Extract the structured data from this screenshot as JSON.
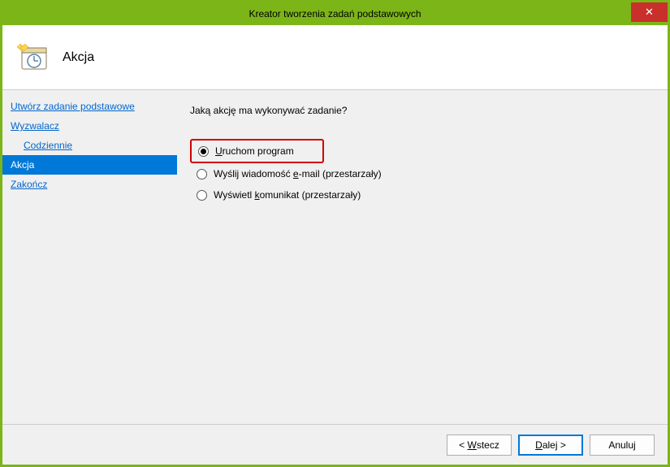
{
  "titlebar": {
    "title": "Kreator tworzenia zadań podstawowych"
  },
  "header": {
    "title": "Akcja"
  },
  "sidebar": {
    "items": [
      {
        "label": "Utwórz zadanie podstawowe",
        "indent": false,
        "active": false
      },
      {
        "label": "Wyzwalacz",
        "indent": false,
        "active": false
      },
      {
        "label": "Codziennie",
        "indent": true,
        "active": false
      },
      {
        "label": "Akcja",
        "indent": false,
        "active": true
      },
      {
        "label": "Zakończ",
        "indent": false,
        "active": false
      }
    ]
  },
  "content": {
    "question": "Jaką akcję ma wykonywać zadanie?",
    "radios": [
      {
        "label_pre": "",
        "accel": "U",
        "label_post": "ruchom program",
        "checked": true,
        "highlight": true
      },
      {
        "label_pre": "Wyślij wiadomość ",
        "accel": "e",
        "label_post": "-mail (przestarzały)",
        "checked": false,
        "highlight": false
      },
      {
        "label_pre": "Wyświetl ",
        "accel": "k",
        "label_post": "omunikat (przestarzały)",
        "checked": false,
        "highlight": false
      }
    ]
  },
  "footer": {
    "back_pre": "< ",
    "back_accel": "W",
    "back_post": "stecz",
    "next_pre": "",
    "next_accel": "D",
    "next_post": "alej >",
    "cancel": "Anuluj"
  }
}
